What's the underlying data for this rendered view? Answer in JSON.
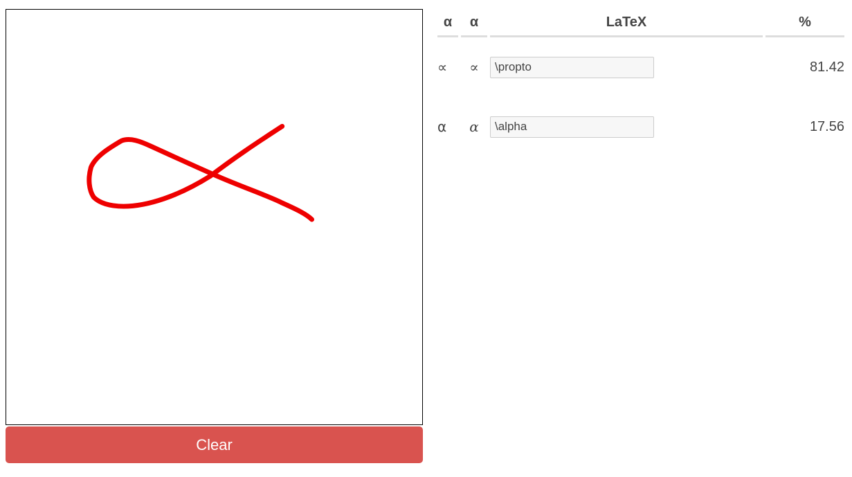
{
  "canvas": {
    "stroke_color": "#ee0000"
  },
  "clear_button": {
    "label": "Clear",
    "color": "#d9534f"
  },
  "table": {
    "headers": {
      "symbol": "α",
      "rendered": "α",
      "latex": "LaTeX",
      "percent": "%"
    },
    "rows": [
      {
        "symbol": "∝",
        "rendered": "∝",
        "latex": "\\propto",
        "percent": "81.42"
      },
      {
        "symbol": "α",
        "rendered": "α",
        "latex": "\\alpha",
        "percent": "17.56"
      }
    ]
  }
}
